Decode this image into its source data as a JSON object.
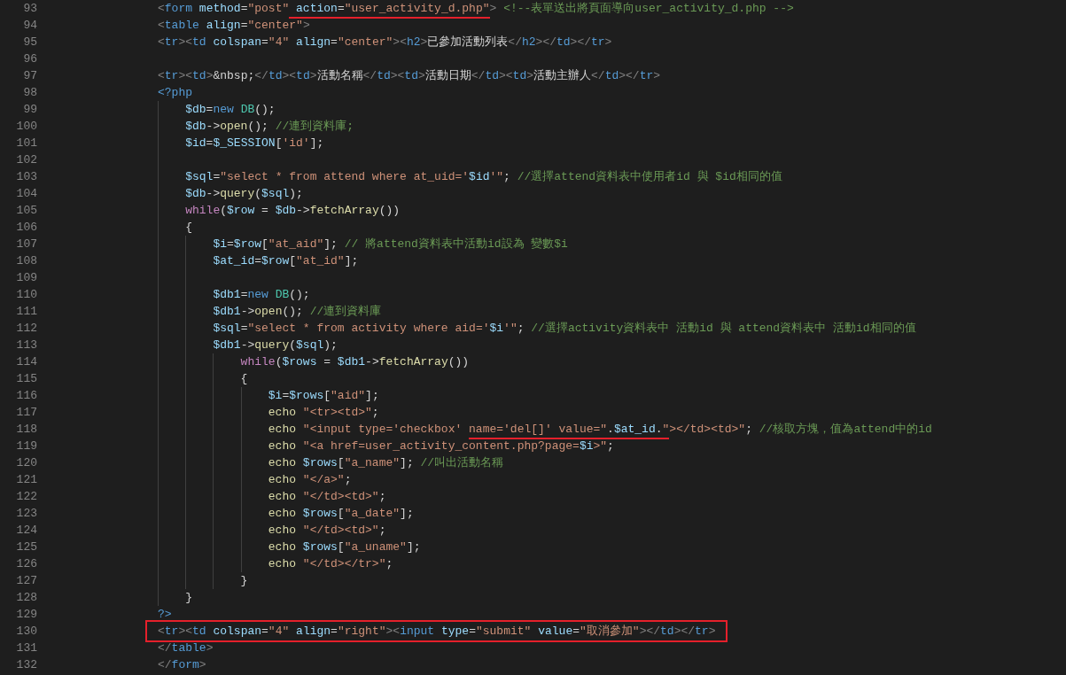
{
  "editor": {
    "lines": [
      {
        "line": "93",
        "tokens": [
          {
            "text": "<",
            "kind": "punctuation"
          },
          {
            "text": "form ",
            "kind": "tag"
          },
          {
            "text": "method",
            "kind": "attribute"
          },
          {
            "text": "=",
            "kind": "plain"
          },
          {
            "text": "\"post\"",
            "kind": "string"
          },
          {
            "text": " action",
            "kind": "attribute",
            "underlined": true
          },
          {
            "text": "=",
            "kind": "plain",
            "underlined": true
          },
          {
            "text": "\"user_activity_d.php\"",
            "kind": "string",
            "underlined": true
          },
          {
            "text": "> ",
            "kind": "punctuation"
          },
          {
            "text": "<!--表單送出將頁面導向user_activity_d.php -->",
            "kind": "comment"
          }
        ]
      },
      {
        "line": "94",
        "tokens": [
          {
            "text": "<",
            "kind": "punctuation"
          },
          {
            "text": "table ",
            "kind": "tag"
          },
          {
            "text": "align",
            "kind": "attribute"
          },
          {
            "text": "=",
            "kind": "plain"
          },
          {
            "text": "\"center\"",
            "kind": "string"
          },
          {
            "text": ">",
            "kind": "punctuation"
          }
        ]
      },
      {
        "line": "95",
        "tokens": [
          {
            "text": "<",
            "kind": "punctuation"
          },
          {
            "text": "tr",
            "kind": "tag"
          },
          {
            "text": "><",
            "kind": "punctuation"
          },
          {
            "text": "td ",
            "kind": "tag"
          },
          {
            "text": "colspan",
            "kind": "attribute"
          },
          {
            "text": "=",
            "kind": "plain"
          },
          {
            "text": "\"4\" ",
            "kind": "string"
          },
          {
            "text": "align",
            "kind": "attribute"
          },
          {
            "text": "=",
            "kind": "plain"
          },
          {
            "text": "\"center\"",
            "kind": "string"
          },
          {
            "text": "><",
            "kind": "punctuation"
          },
          {
            "text": "h2",
            "kind": "tag"
          },
          {
            "text": ">",
            "kind": "punctuation"
          },
          {
            "text": "已參加活動列表",
            "kind": "plain"
          },
          {
            "text": "</",
            "kind": "punctuation"
          },
          {
            "text": "h2",
            "kind": "tag"
          },
          {
            "text": "></",
            "kind": "punctuation"
          },
          {
            "text": "td",
            "kind": "tag"
          },
          {
            "text": "></",
            "kind": "punctuation"
          },
          {
            "text": "tr",
            "kind": "tag"
          },
          {
            "text": ">",
            "kind": "punctuation"
          }
        ]
      },
      {
        "line": "96"
      },
      {
        "line": "97",
        "tokens": [
          {
            "text": "<",
            "kind": "punctuation"
          },
          {
            "text": "tr",
            "kind": "tag"
          },
          {
            "text": "><",
            "kind": "punctuation"
          },
          {
            "text": "td",
            "kind": "tag"
          },
          {
            "text": ">",
            "kind": "punctuation"
          },
          {
            "text": "&nbsp;",
            "kind": "plain"
          },
          {
            "text": "</",
            "kind": "punctuation"
          },
          {
            "text": "td",
            "kind": "tag"
          },
          {
            "text": "><",
            "kind": "punctuation"
          },
          {
            "text": "td",
            "kind": "tag"
          },
          {
            "text": ">",
            "kind": "punctuation"
          },
          {
            "text": "活動名稱",
            "kind": "plain"
          },
          {
            "text": "</",
            "kind": "punctuation"
          },
          {
            "text": "td",
            "kind": "tag"
          },
          {
            "text": "><",
            "kind": "punctuation"
          },
          {
            "text": "td",
            "kind": "tag"
          },
          {
            "text": ">",
            "kind": "punctuation"
          },
          {
            "text": "活動日期",
            "kind": "plain"
          },
          {
            "text": "</",
            "kind": "punctuation"
          },
          {
            "text": "td",
            "kind": "tag"
          },
          {
            "text": "><",
            "kind": "punctuation"
          },
          {
            "text": "td",
            "kind": "tag"
          },
          {
            "text": ">",
            "kind": "punctuation"
          },
          {
            "text": "活動主辦人",
            "kind": "plain"
          },
          {
            "text": "</",
            "kind": "punctuation"
          },
          {
            "text": "td",
            "kind": "tag"
          },
          {
            "text": "></",
            "kind": "punctuation"
          },
          {
            "text": "tr",
            "kind": "tag"
          },
          {
            "text": ">",
            "kind": "punctuation"
          }
        ]
      },
      {
        "line": "98",
        "tokens": [
          {
            "text": "<?php",
            "kind": "tag"
          }
        ]
      },
      {
        "line": "99",
        "tokens": [
          {
            "text": "    $db",
            "kind": "variable"
          },
          {
            "text": "=",
            "kind": "plain"
          },
          {
            "text": "new ",
            "kind": "keyword"
          },
          {
            "text": "DB",
            "kind": "class"
          },
          {
            "text": "();",
            "kind": "plain"
          }
        ]
      },
      {
        "line": "100",
        "tokens": [
          {
            "text": "    $db",
            "kind": "variable"
          },
          {
            "text": "->",
            "kind": "plain"
          },
          {
            "text": "open",
            "kind": "function"
          },
          {
            "text": "(); ",
            "kind": "plain"
          },
          {
            "text": "//連到資料庫;",
            "kind": "comment"
          }
        ]
      },
      {
        "line": "101",
        "tokens": [
          {
            "text": "    $id",
            "kind": "variable"
          },
          {
            "text": "=",
            "kind": "plain"
          },
          {
            "text": "$_SESSION",
            "kind": "variable"
          },
          {
            "text": "[",
            "kind": "plain"
          },
          {
            "text": "'id'",
            "kind": "string"
          },
          {
            "text": "];",
            "kind": "plain"
          }
        ]
      },
      {
        "line": "102"
      },
      {
        "line": "103",
        "tokens": [
          {
            "text": "    $sql",
            "kind": "variable"
          },
          {
            "text": "=",
            "kind": "plain"
          },
          {
            "text": "\"select * from attend where at_uid='",
            "kind": "string"
          },
          {
            "text": "$id",
            "kind": "variable"
          },
          {
            "text": "'\"",
            "kind": "string"
          },
          {
            "text": "; ",
            "kind": "plain"
          },
          {
            "text": "//選擇attend資料表中使用者id 與 $id相同的值",
            "kind": "comment"
          }
        ]
      },
      {
        "line": "104",
        "tokens": [
          {
            "text": "    $db",
            "kind": "variable"
          },
          {
            "text": "->",
            "kind": "plain"
          },
          {
            "text": "query",
            "kind": "function"
          },
          {
            "text": "(",
            "kind": "plain"
          },
          {
            "text": "$sql",
            "kind": "variable"
          },
          {
            "text": ");",
            "kind": "plain"
          }
        ]
      },
      {
        "line": "105",
        "tokens": [
          {
            "text": "    while",
            "kind": "control"
          },
          {
            "text": "(",
            "kind": "plain"
          },
          {
            "text": "$row",
            "kind": "variable"
          },
          {
            "text": " = ",
            "kind": "plain"
          },
          {
            "text": "$db",
            "kind": "variable"
          },
          {
            "text": "->",
            "kind": "plain"
          },
          {
            "text": "fetchArray",
            "kind": "function"
          },
          {
            "text": "())",
            "kind": "plain"
          }
        ]
      },
      {
        "line": "106",
        "tokens": [
          {
            "text": "    {",
            "kind": "plain"
          }
        ]
      },
      {
        "line": "107",
        "tokens": [
          {
            "text": "        $i",
            "kind": "variable"
          },
          {
            "text": "=",
            "kind": "plain"
          },
          {
            "text": "$row",
            "kind": "variable"
          },
          {
            "text": "[",
            "kind": "plain"
          },
          {
            "text": "\"at_aid\"",
            "kind": "string"
          },
          {
            "text": "]; ",
            "kind": "plain"
          },
          {
            "text": "// 將attend資料表中活動id設為 變數$i",
            "kind": "comment"
          }
        ]
      },
      {
        "line": "108",
        "tokens": [
          {
            "text": "        $at_id",
            "kind": "variable"
          },
          {
            "text": "=",
            "kind": "plain"
          },
          {
            "text": "$row",
            "kind": "variable"
          },
          {
            "text": "[",
            "kind": "plain"
          },
          {
            "text": "\"at_id\"",
            "kind": "string"
          },
          {
            "text": "];",
            "kind": "plain"
          }
        ]
      },
      {
        "line": "109"
      },
      {
        "line": "110",
        "tokens": [
          {
            "text": "        $db1",
            "kind": "variable"
          },
          {
            "text": "=",
            "kind": "plain"
          },
          {
            "text": "new ",
            "kind": "keyword"
          },
          {
            "text": "DB",
            "kind": "class"
          },
          {
            "text": "();",
            "kind": "plain"
          }
        ]
      },
      {
        "line": "111",
        "tokens": [
          {
            "text": "        $db1",
            "kind": "variable"
          },
          {
            "text": "->",
            "kind": "plain"
          },
          {
            "text": "open",
            "kind": "function"
          },
          {
            "text": "(); ",
            "kind": "plain"
          },
          {
            "text": "//連到資料庫",
            "kind": "comment"
          }
        ]
      },
      {
        "line": "112",
        "tokens": [
          {
            "text": "        $sql",
            "kind": "variable"
          },
          {
            "text": "=",
            "kind": "plain"
          },
          {
            "text": "\"select * from activity where aid='",
            "kind": "string"
          },
          {
            "text": "$i",
            "kind": "variable"
          },
          {
            "text": "'\"",
            "kind": "string"
          },
          {
            "text": "; ",
            "kind": "plain"
          },
          {
            "text": "//選擇activity資料表中 活動id 與 attend資料表中 活動id相同的值",
            "kind": "comment"
          }
        ]
      },
      {
        "line": "113",
        "tokens": [
          {
            "text": "        $db1",
            "kind": "variable"
          },
          {
            "text": "->",
            "kind": "plain"
          },
          {
            "text": "query",
            "kind": "function"
          },
          {
            "text": "(",
            "kind": "plain"
          },
          {
            "text": "$sql",
            "kind": "variable"
          },
          {
            "text": ");",
            "kind": "plain"
          }
        ]
      },
      {
        "line": "114",
        "tokens": [
          {
            "text": "            while",
            "kind": "control"
          },
          {
            "text": "(",
            "kind": "plain"
          },
          {
            "text": "$rows",
            "kind": "variable"
          },
          {
            "text": " = ",
            "kind": "plain"
          },
          {
            "text": "$db1",
            "kind": "variable"
          },
          {
            "text": "->",
            "kind": "plain"
          },
          {
            "text": "fetchArray",
            "kind": "function"
          },
          {
            "text": "())",
            "kind": "plain"
          }
        ]
      },
      {
        "line": "115",
        "tokens": [
          {
            "text": "            {",
            "kind": "plain"
          }
        ]
      },
      {
        "line": "116",
        "tokens": [
          {
            "text": "                $i",
            "kind": "variable"
          },
          {
            "text": "=",
            "kind": "plain"
          },
          {
            "text": "$rows",
            "kind": "variable"
          },
          {
            "text": "[",
            "kind": "plain"
          },
          {
            "text": "\"aid\"",
            "kind": "string"
          },
          {
            "text": "];",
            "kind": "plain"
          }
        ]
      },
      {
        "line": "117",
        "tokens": [
          {
            "text": "                echo ",
            "kind": "function"
          },
          {
            "text": "\"<tr><td>\"",
            "kind": "string"
          },
          {
            "text": ";",
            "kind": "plain"
          }
        ]
      },
      {
        "line": "118",
        "tokens": [
          {
            "text": "                echo ",
            "kind": "function"
          },
          {
            "text": "\"<input type='checkbox' ",
            "kind": "string"
          },
          {
            "text": "name='del[]' value=\"",
            "kind": "string",
            "underlined": true
          },
          {
            "text": ".",
            "kind": "plain",
            "underlined": true
          },
          {
            "text": "$at_id",
            "kind": "variable",
            "underlined": true
          },
          {
            "text": ".",
            "kind": "plain",
            "underlined": true
          },
          {
            "text": "\"",
            "kind": "string",
            "underlined": true
          },
          {
            "text": "></td><td>\"",
            "kind": "string"
          },
          {
            "text": "; ",
            "kind": "plain"
          },
          {
            "text": "//核取方塊，值為attend中的id",
            "kind": "comment"
          }
        ]
      },
      {
        "line": "119",
        "tokens": [
          {
            "text": "                echo ",
            "kind": "function"
          },
          {
            "text": "\"<a href=user_activity_content.php?page=",
            "kind": "string"
          },
          {
            "text": "$i",
            "kind": "variable"
          },
          {
            "text": ">\"",
            "kind": "string"
          },
          {
            "text": ";",
            "kind": "plain"
          }
        ]
      },
      {
        "line": "120",
        "tokens": [
          {
            "text": "                echo ",
            "kind": "function"
          },
          {
            "text": "$rows",
            "kind": "variable"
          },
          {
            "text": "[",
            "kind": "plain"
          },
          {
            "text": "\"a_name\"",
            "kind": "string"
          },
          {
            "text": "]; ",
            "kind": "plain"
          },
          {
            "text": "//叫出活動名稱",
            "kind": "comment"
          }
        ]
      },
      {
        "line": "121",
        "tokens": [
          {
            "text": "                echo ",
            "kind": "function"
          },
          {
            "text": "\"</a>\"",
            "kind": "string"
          },
          {
            "text": ";",
            "kind": "plain"
          }
        ]
      },
      {
        "line": "122",
        "tokens": [
          {
            "text": "                echo ",
            "kind": "function"
          },
          {
            "text": "\"</td><td>\"",
            "kind": "string"
          },
          {
            "text": ";",
            "kind": "plain"
          }
        ]
      },
      {
        "line": "123",
        "tokens": [
          {
            "text": "                echo ",
            "kind": "function"
          },
          {
            "text": "$rows",
            "kind": "variable"
          },
          {
            "text": "[",
            "kind": "plain"
          },
          {
            "text": "\"a_date\"",
            "kind": "string"
          },
          {
            "text": "];",
            "kind": "plain"
          }
        ]
      },
      {
        "line": "124",
        "tokens": [
          {
            "text": "                echo ",
            "kind": "function"
          },
          {
            "text": "\"</td><td>\"",
            "kind": "string"
          },
          {
            "text": ";",
            "kind": "plain"
          }
        ]
      },
      {
        "line": "125",
        "tokens": [
          {
            "text": "                echo ",
            "kind": "function"
          },
          {
            "text": "$rows",
            "kind": "variable"
          },
          {
            "text": "[",
            "kind": "plain"
          },
          {
            "text": "\"a_uname\"",
            "kind": "string"
          },
          {
            "text": "];",
            "kind": "plain"
          }
        ]
      },
      {
        "line": "126",
        "tokens": [
          {
            "text": "                echo ",
            "kind": "function"
          },
          {
            "text": "\"</td></tr>\"",
            "kind": "string"
          },
          {
            "text": ";",
            "kind": "plain"
          }
        ]
      },
      {
        "line": "127",
        "tokens": [
          {
            "text": "            }",
            "kind": "plain"
          }
        ]
      },
      {
        "line": "128",
        "tokens": [
          {
            "text": "    }",
            "kind": "plain"
          }
        ]
      },
      {
        "line": "129",
        "tokens": [
          {
            "text": "?>",
            "kind": "tag"
          }
        ]
      },
      {
        "line": "130",
        "boxed": true,
        "tokens": [
          {
            "text": "<",
            "kind": "punctuation"
          },
          {
            "text": "tr",
            "kind": "tag"
          },
          {
            "text": "><",
            "kind": "punctuation"
          },
          {
            "text": "td ",
            "kind": "tag"
          },
          {
            "text": "colspan",
            "kind": "attribute"
          },
          {
            "text": "=",
            "kind": "plain"
          },
          {
            "text": "\"4\" ",
            "kind": "string"
          },
          {
            "text": "align",
            "kind": "attribute"
          },
          {
            "text": "=",
            "kind": "plain"
          },
          {
            "text": "\"right\"",
            "kind": "string"
          },
          {
            "text": "><",
            "kind": "punctuation"
          },
          {
            "text": "input ",
            "kind": "tag"
          },
          {
            "text": "type",
            "kind": "attribute"
          },
          {
            "text": "=",
            "kind": "plain"
          },
          {
            "text": "\"submit\" ",
            "kind": "string"
          },
          {
            "text": "value",
            "kind": "attribute"
          },
          {
            "text": "=",
            "kind": "plain"
          },
          {
            "text": "\"取消參加\"",
            "kind": "string"
          },
          {
            "text": "></",
            "kind": "punctuation"
          },
          {
            "text": "td",
            "kind": "tag"
          },
          {
            "text": "></",
            "kind": "punctuation"
          },
          {
            "text": "tr",
            "kind": "tag"
          },
          {
            "text": ">",
            "kind": "punctuation"
          }
        ]
      },
      {
        "line": "131",
        "tokens": [
          {
            "text": "</",
            "kind": "punctuation"
          },
          {
            "text": "table",
            "kind": "tag"
          },
          {
            "text": ">",
            "kind": "punctuation"
          }
        ]
      },
      {
        "line": "132",
        "tokens": [
          {
            "text": "</",
            "kind": "punctuation"
          },
          {
            "text": "form",
            "kind": "tag"
          },
          {
            "text": ">",
            "kind": "punctuation"
          }
        ]
      }
    ]
  }
}
